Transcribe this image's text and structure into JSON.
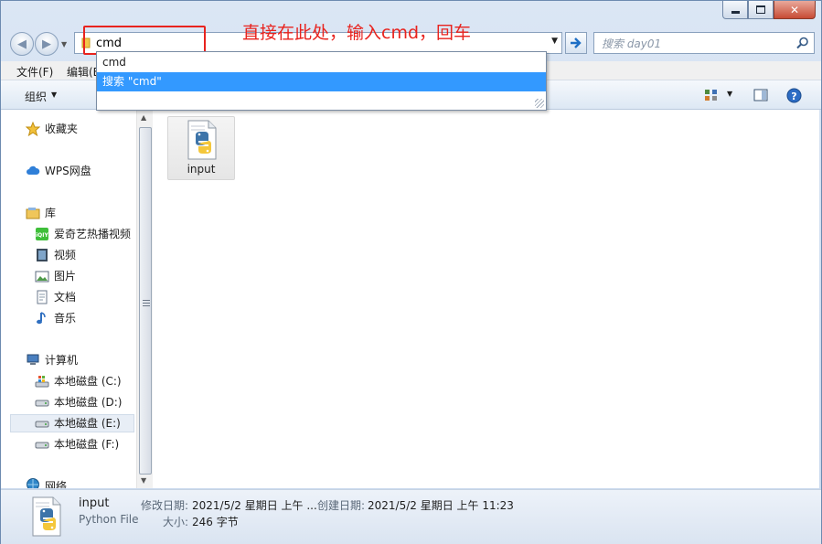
{
  "window": {
    "minimize": "−",
    "maximize": "□",
    "close": "✕"
  },
  "address": {
    "value": "cmd"
  },
  "search": {
    "placeholder": "搜索 day01"
  },
  "annotation": "直接在此处，输入cmd，回车",
  "dropdown": {
    "items": [
      "cmd",
      "搜索 \"cmd\""
    ]
  },
  "menubar": {
    "items": [
      "文件(F)",
      "编辑(E)"
    ]
  },
  "toolbar": {
    "organize": "组织"
  },
  "nav": {
    "favorites": "收藏夹",
    "wps": "WPS网盘",
    "libraries": "库",
    "lib_items": [
      "爱奇艺热播视频",
      "视频",
      "图片",
      "文档",
      "音乐"
    ],
    "computer": "计算机",
    "drives": [
      "本地磁盘 (C:)",
      "本地磁盘 (D:)",
      "本地磁盘 (E:)",
      "本地磁盘 (F:)"
    ],
    "network": "网络"
  },
  "files": [
    {
      "name": "input",
      "icon": "python-file-icon"
    }
  ],
  "details": {
    "name": "input",
    "type": "Python File",
    "modified_label": "修改日期:",
    "modified_value": "2021/5/2 星期日 上午 ...",
    "created_label": "创建日期:",
    "created_value": "2021/5/2 星期日 上午 11:23",
    "size_label": "大小:",
    "size_value": "246 字节"
  },
  "colors": {
    "annotation": "#e8231e",
    "selection": "#3399ff"
  }
}
